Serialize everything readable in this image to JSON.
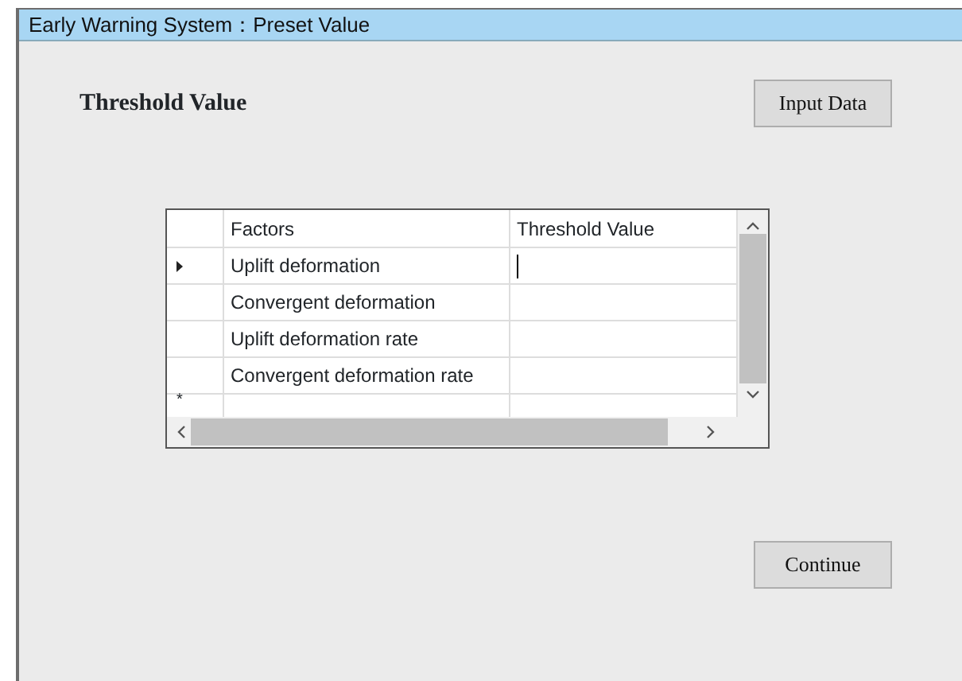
{
  "window": {
    "title": "Early Warning System：Preset Value"
  },
  "heading": "Threshold Value",
  "input_button": "Input Data",
  "grid": {
    "columns": [
      "Factors",
      "Threshold Value"
    ],
    "rows": [
      {
        "factor": "Uplift deformation",
        "value": "",
        "selected": true
      },
      {
        "factor": "Convergent deformation",
        "value": "",
        "selected": false
      },
      {
        "factor": "Uplift deformation rate",
        "value": "",
        "selected": false
      },
      {
        "factor": "Convergent deformation rate",
        "value": "",
        "selected": false
      }
    ],
    "new_row_marker": "*"
  },
  "continue_button": "Continue"
}
